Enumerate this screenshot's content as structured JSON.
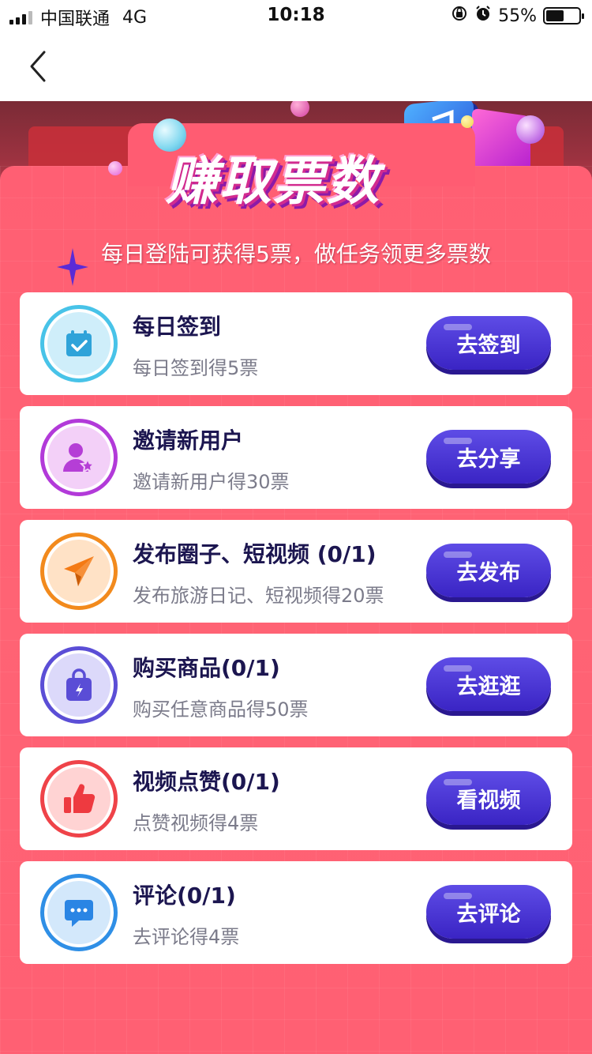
{
  "status_bar": {
    "carrier": "中国联通",
    "network": "4G",
    "time": "10:18",
    "battery": "55%",
    "battery_level": 0.55
  },
  "hero": {
    "title": "赚取票数",
    "subtitle": "每日登陆可获得5票，做任务领更多票数"
  },
  "tasks": [
    {
      "title": "每日签到",
      "desc": "每日签到得5票",
      "button": "去签到",
      "icon": "calendar-check-icon",
      "ring": "#48c3e8",
      "inner": "#cfeefa",
      "glyph": "#2fa3d9"
    },
    {
      "title": "邀请新用户",
      "desc": "邀请新用户得30票",
      "button": "去分享",
      "icon": "user-star-icon",
      "ring": "#b23ad9",
      "inner": "#f3d0f8",
      "glyph": "#b53ed6"
    },
    {
      "title": "发布圈子、短视频 (0/1)",
      "desc": "发布旅游日记、短视频得20票",
      "button": "去发布",
      "icon": "paper-plane-icon",
      "ring": "#f28a1d",
      "inner": "#ffe2c6",
      "glyph": "#f47a14"
    },
    {
      "title": "购买商品(0/1)",
      "desc": "购买任意商品得50票",
      "button": "去逛逛",
      "icon": "shopping-bag-icon",
      "ring": "#5b4ed6",
      "inner": "#dcd9fa",
      "glyph": "#5a4dd6"
    },
    {
      "title": "视频点赞(0/1)",
      "desc": "点赞视频得4票",
      "button": "看视频",
      "icon": "thumbs-up-icon",
      "ring": "#ef4349",
      "inner": "#ffd3d3",
      "glyph": "#ee3a40"
    },
    {
      "title": "评论(0/1)",
      "desc": "去评论得4票",
      "button": "去评论",
      "icon": "comment-icon",
      "ring": "#2f8fe6",
      "inner": "#d3e8fb",
      "glyph": "#2a85e4"
    }
  ]
}
